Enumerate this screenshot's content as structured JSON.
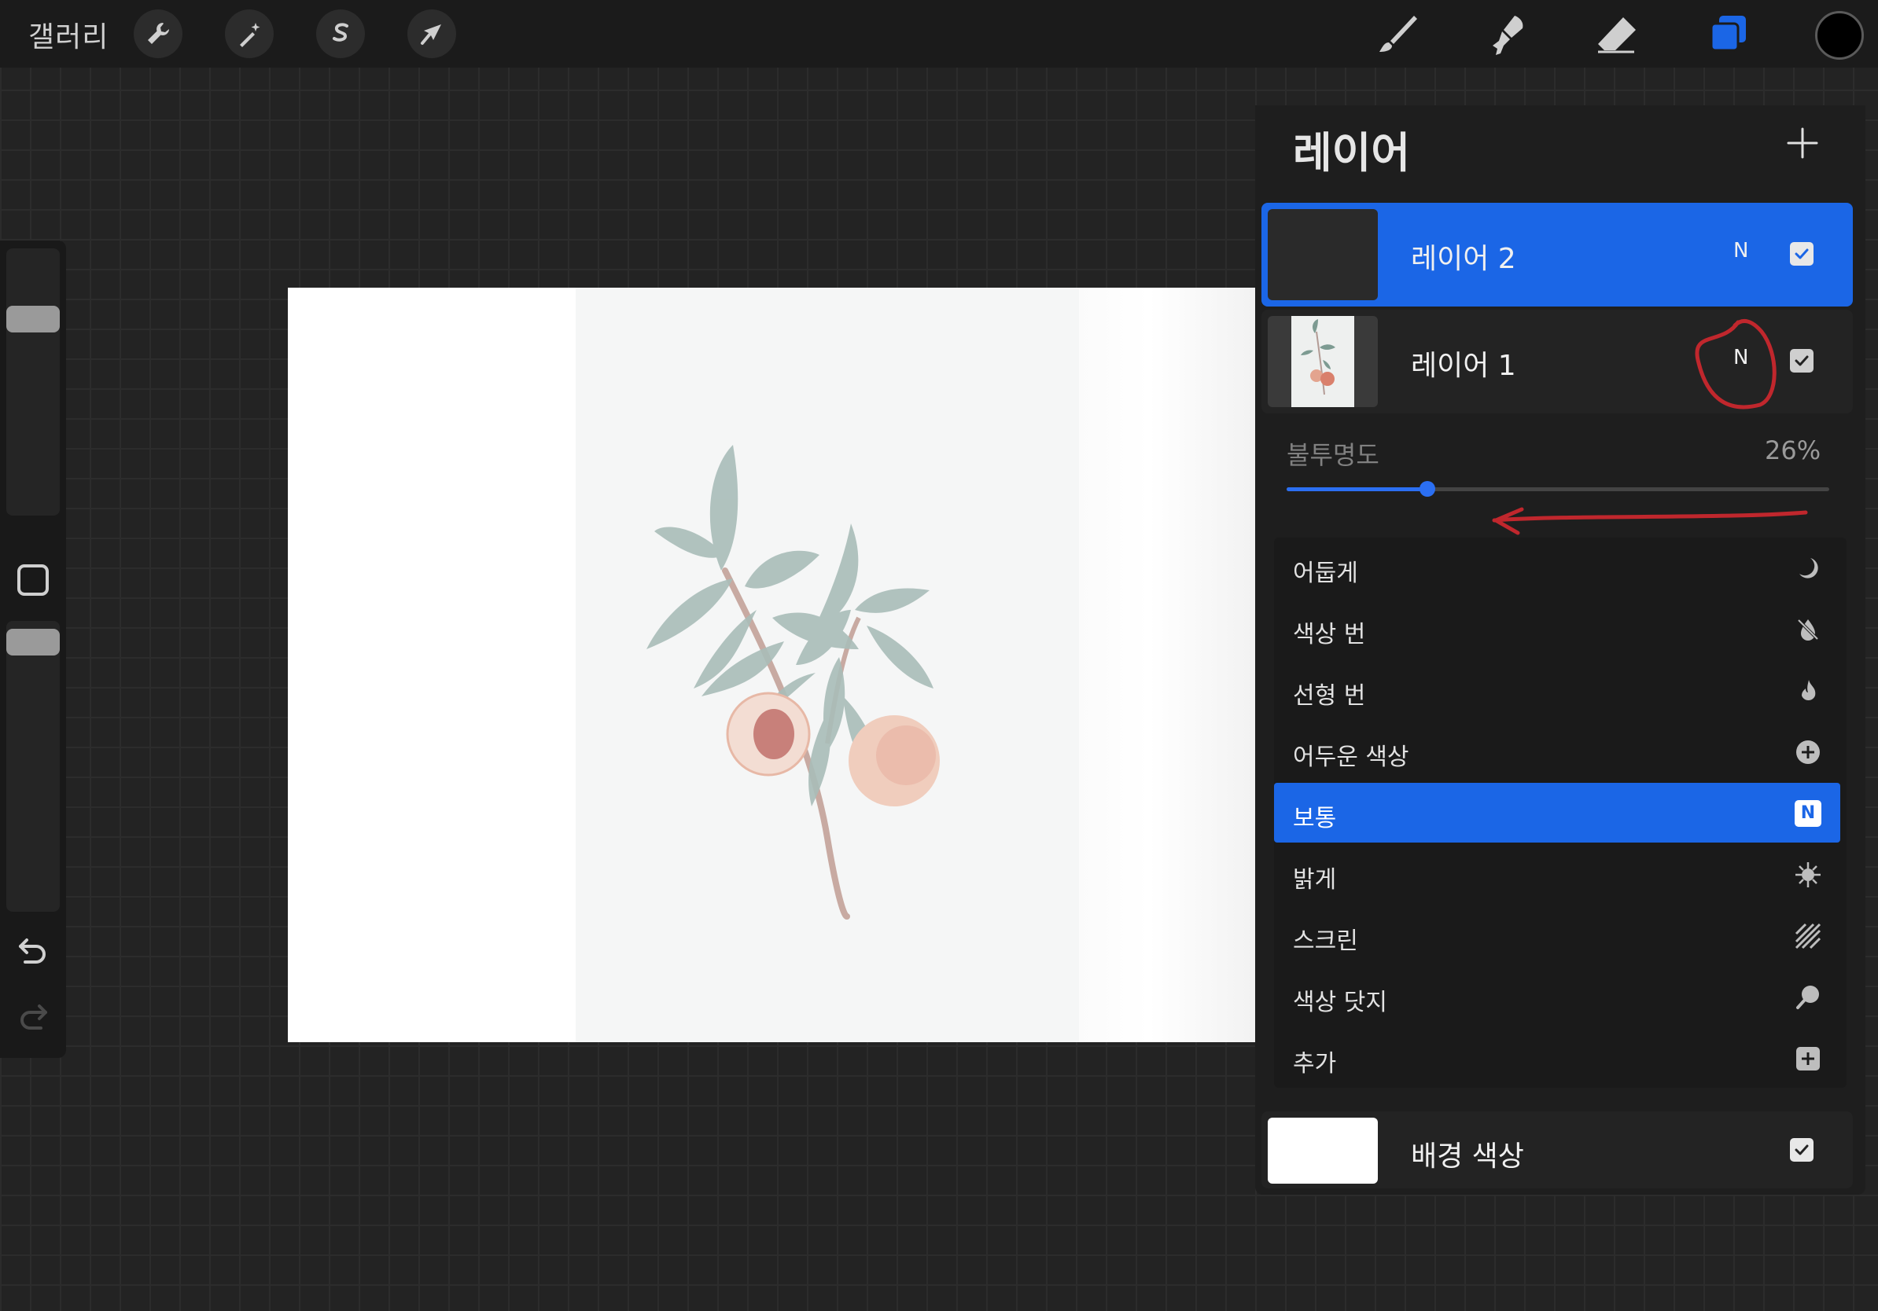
{
  "topbar": {
    "gallery_label": "갤러리",
    "left_tools": [
      "wrench-icon",
      "magic-wand-icon",
      "selection-icon",
      "transform-arrow-icon"
    ],
    "right_tools": [
      "brush-icon",
      "smudge-icon",
      "eraser-icon",
      "layers-icon"
    ],
    "current_color": "#000000"
  },
  "sidebar": {
    "brush_size_level": 0.76,
    "brush_opacity_level": 0.97
  },
  "layers_panel": {
    "title": "레이어",
    "layers": [
      {
        "name": "레이어 2",
        "blend": "N",
        "visible": true,
        "selected": true
      },
      {
        "name": "레이어 1",
        "blend": "N",
        "visible": true,
        "selected": false
      }
    ],
    "opacity": {
      "label": "불투명도",
      "value_text": "26%",
      "value": 0.26
    },
    "blend_modes": [
      {
        "label": "어둡게",
        "icon": "moon-icon"
      },
      {
        "label": "색상 번",
        "icon": "crossed-drop-icon"
      },
      {
        "label": "선형 번",
        "icon": "flame-icon"
      },
      {
        "label": "어두운 색상",
        "icon": "plus-circle-icon"
      },
      {
        "label": "보통",
        "icon": "normal-n-icon",
        "active": true
      },
      {
        "label": "밝게",
        "icon": "sunburst-icon"
      },
      {
        "label": "스크린",
        "icon": "hatch-icon"
      },
      {
        "label": "색상 닷지",
        "icon": "dodge-icon"
      },
      {
        "label": "추가",
        "icon": "plus-square-icon"
      }
    ],
    "normal_badge": "N",
    "background": {
      "name": "배경 색상",
      "visible": true,
      "color": "#ffffff"
    }
  },
  "colors": {
    "accent": "#1b66e6",
    "annotation_red": "#c0272d"
  }
}
